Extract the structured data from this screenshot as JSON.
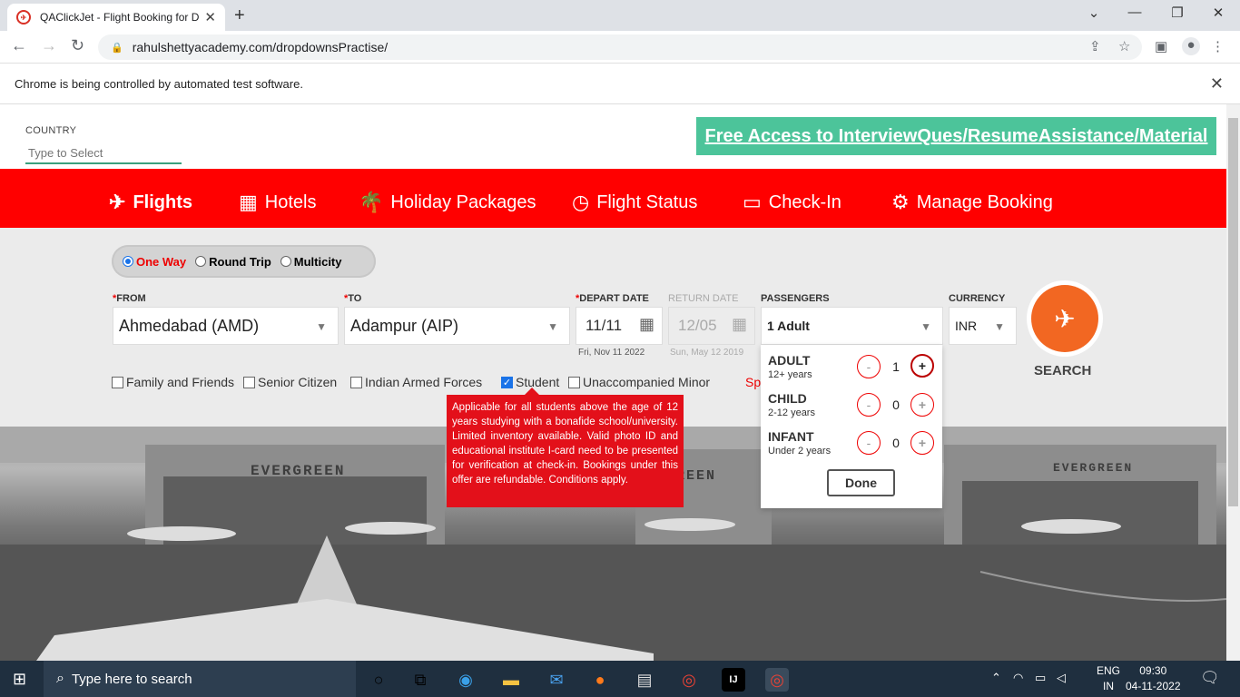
{
  "browser": {
    "tab_title": "QAClickJet - Flight Booking for D",
    "url": "rahulshettyacademy.com/dropdownsPractise/",
    "infobar_text": "Chrome is being controlled by automated test software."
  },
  "page": {
    "country_label": "COUNTRY",
    "country_placeholder": "Type to Select",
    "free_access": "Free Access to InterviewQues/ResumeAssistance/Material",
    "nav": [
      {
        "label": "Flights",
        "icon": "plane-icon"
      },
      {
        "label": "Hotels",
        "icon": "hotel-icon"
      },
      {
        "label": "Holiday Packages",
        "icon": "palm-tree-icon"
      },
      {
        "label": "Flight Status",
        "icon": "clock-icon"
      },
      {
        "label": "Check-In",
        "icon": "ticket-icon"
      },
      {
        "label": "Manage Booking",
        "icon": "gear-icon"
      }
    ],
    "trip_types": [
      "One Way",
      "Round Trip",
      "Multicity"
    ],
    "trip_selected": "One Way",
    "from_label": "FROM",
    "from_value": "Ahmedabad (AMD)",
    "to_label": "TO",
    "to_value": "Adampur (AIP)",
    "depart_label": "DEPART DATE",
    "depart_value": "11/11",
    "depart_sub": "Fri, Nov 11 2022",
    "return_label": "RETURN DATE",
    "return_value": "12/05",
    "return_sub": "Sun, May 12 2019",
    "passengers_label": "PASSENGERS",
    "passengers_value": "1 Adult",
    "currency_label": "CURRENCY",
    "currency_value": "INR",
    "search_label": "SEARCH",
    "checkboxes": [
      {
        "label": "Family and Friends",
        "checked": false
      },
      {
        "label": "Senior Citizen",
        "checked": false
      },
      {
        "label": "Indian Armed Forces",
        "checked": false
      },
      {
        "label": "Student",
        "checked": true
      },
      {
        "label": "Unaccompanied Minor",
        "checked": false
      }
    ],
    "tooltip": "Applicable for all students above the age of 12 years studying with a bonafide school/university. Limited inventory available. Valid photo ID and educational institute I-card need to be presented for verification at check-in. Bookings under this offer are refundable. Conditions apply.",
    "sp_text": "Sp",
    "pax": [
      {
        "label": "ADULT",
        "sub": "12+ years",
        "count": "1"
      },
      {
        "label": "CHILD",
        "sub": "2-12 years",
        "count": "0"
      },
      {
        "label": "INFANT",
        "sub": "Under 2 years",
        "count": "0"
      }
    ],
    "minus": "-",
    "plus": "+",
    "done": "Done",
    "hangar_text": "EVERGREEN",
    "hangar_text2": "REEN"
  },
  "taskbar": {
    "search_placeholder": "Type here to search",
    "lang1": "ENG",
    "lang2": "IN",
    "time": "09:30",
    "date": "04-11-2022"
  }
}
